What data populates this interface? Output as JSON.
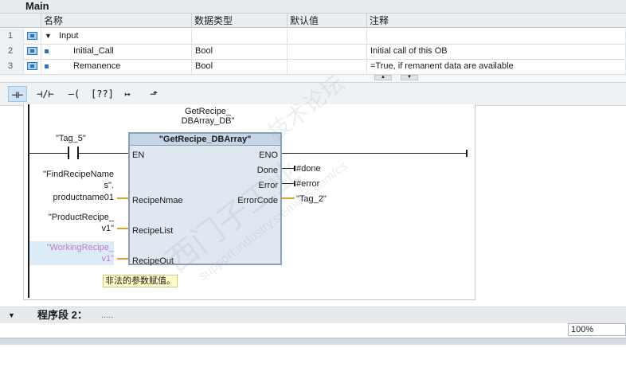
{
  "window_title": "Main",
  "columns": [
    "名称",
    "数据类型",
    "默认值",
    "注释"
  ],
  "rows": [
    {
      "num": "1",
      "name": "Input",
      "type": "",
      "default": "",
      "comment": ""
    },
    {
      "num": "2",
      "name": "Initial_Call",
      "type": "Bool",
      "default": "",
      "comment": "Initial call of this OB"
    },
    {
      "num": "3",
      "name": "Remanence",
      "type": "Bool",
      "default": "",
      "comment": "=True, if remanent data are available"
    }
  ],
  "toolbar": [
    "⊣⊢",
    "⊣/⊢",
    "–( )–",
    "[??]",
    "↦",
    "⬏"
  ],
  "instance_db": [
    "GetRecipe_",
    "DBArray_DB\""
  ],
  "block_name": "\"GetRecipe_DBArray\"",
  "pins_left": [
    "EN",
    "RecipeNmae",
    "RecipeList",
    "RecipeOut"
  ],
  "pins_right": [
    "ENO",
    "Done",
    "Error",
    "ErrorCode"
  ],
  "contact_tag": "\"Tag_5\"",
  "left_ops": {
    "recipe_name": [
      "\"FindRecipeName",
      "s\".",
      "productname01"
    ],
    "recipe_list": [
      "\"ProductRecipe_",
      "v1\""
    ],
    "recipe_out": [
      "\"WorkingRecipe_",
      "v1\""
    ]
  },
  "right_ops": [
    "#done",
    "#error",
    "\"Tag_2\""
  ],
  "warning": "非法的参数赋值。",
  "segment_label": "程序段 2：",
  "segment_comment": ".....",
  "zoom": "100%",
  "watermark": [
    "西门子工业",
    "support.industry.siemens.com/cs",
    "技术论坛"
  ]
}
